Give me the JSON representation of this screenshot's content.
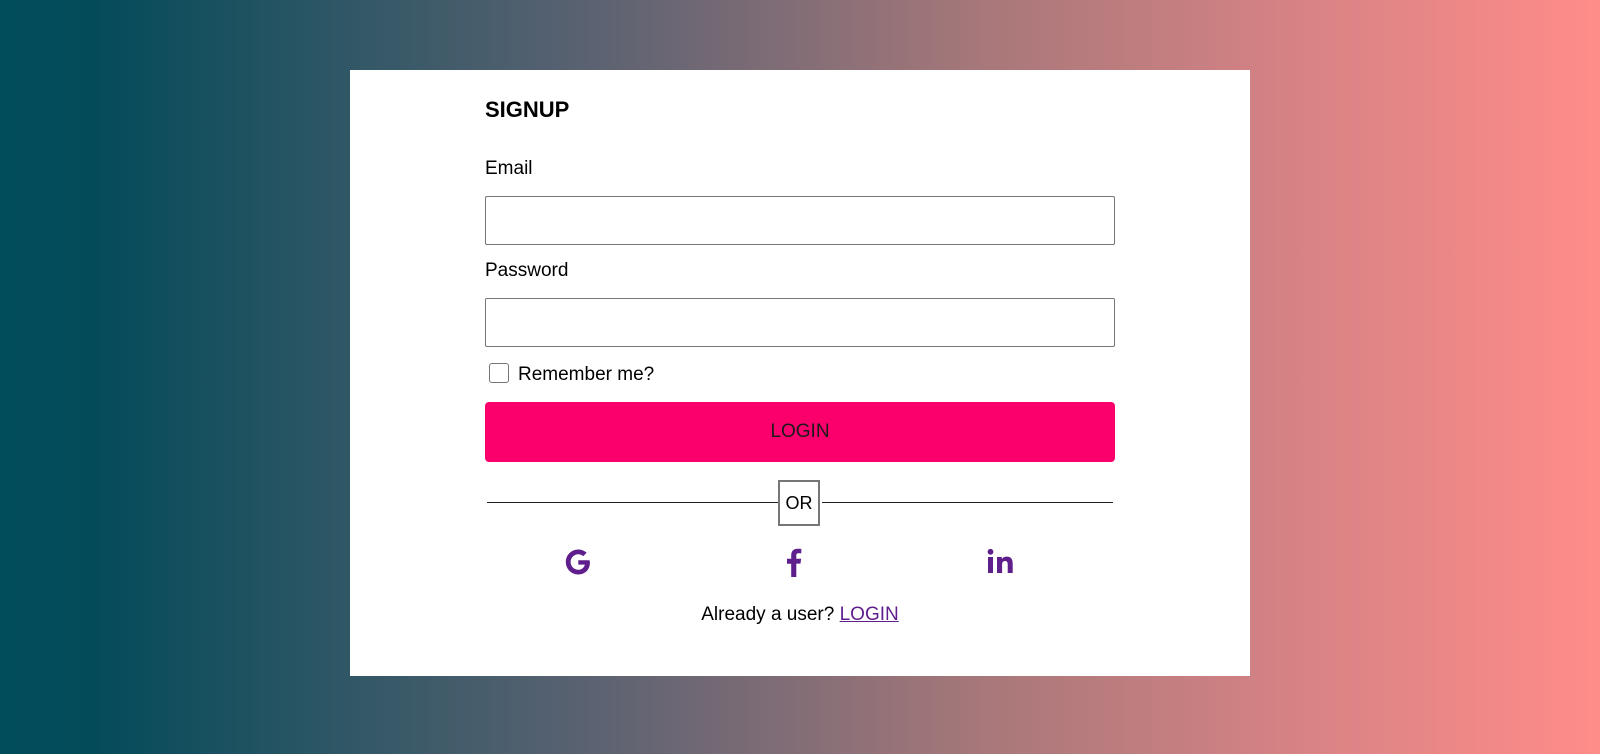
{
  "form": {
    "title": "SIGNUP",
    "email_label": "Email",
    "email_value": "",
    "password_label": "Password",
    "password_value": "",
    "remember_label": "Remember me?",
    "remember_checked": false,
    "login_button": "LOGIN",
    "divider_text": "OR"
  },
  "social": {
    "icons": [
      "google-icon",
      "facebook-icon",
      "linkedin-icon"
    ],
    "icon_color": "#5e1e8c"
  },
  "footer": {
    "prompt": "Already a user?",
    "link": "LOGIN"
  },
  "colors": {
    "button": "#fb006d",
    "gradient_start": "#024d5c",
    "gradient_end": "#ff8c89"
  }
}
